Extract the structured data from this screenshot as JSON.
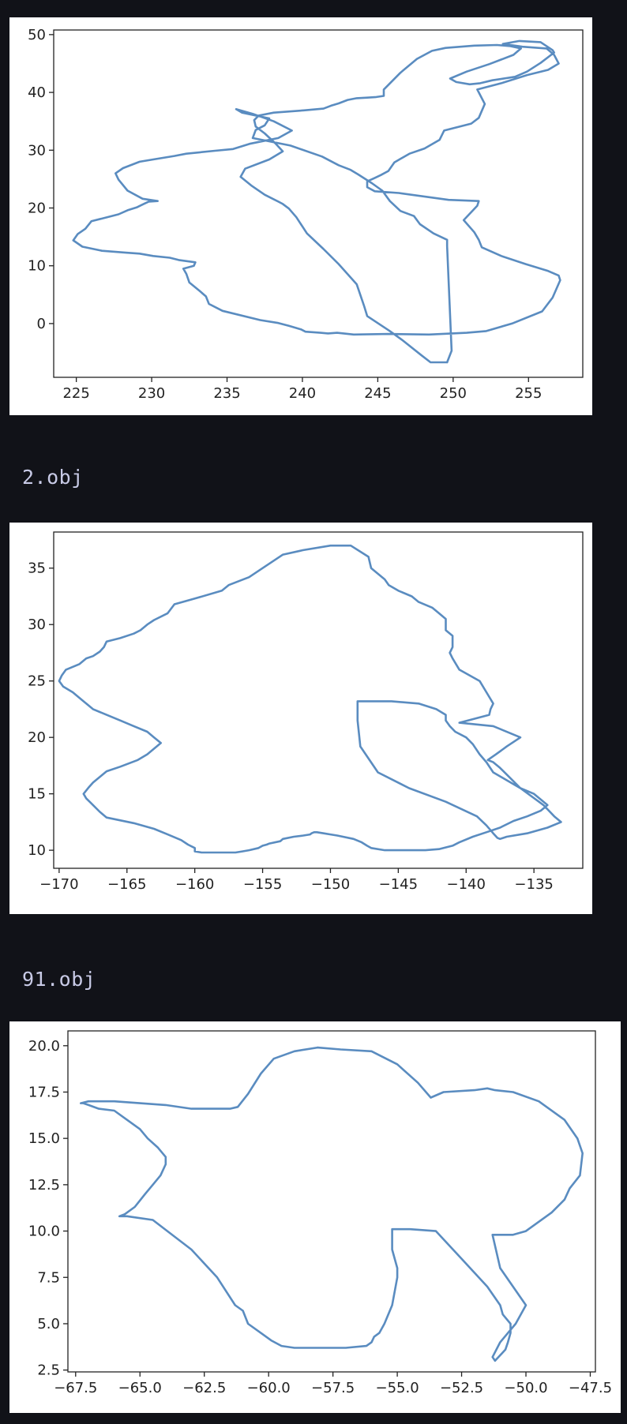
{
  "captions": [
    "2.obj",
    "91.obj"
  ],
  "colors": {
    "line": "#5a8cc0",
    "background": "#111218",
    "caption": "#c8cae6"
  },
  "chart_data": [
    {
      "type": "line",
      "title": "",
      "xlabel": "",
      "ylabel": "",
      "xlim": [
        223.5,
        258.6
      ],
      "ylim": [
        -9.3,
        50.8
      ],
      "xticks": [
        225,
        230,
        235,
        240,
        245,
        250,
        255
      ],
      "yticks": [
        0,
        10,
        20,
        30,
        40,
        50
      ],
      "grid": false,
      "legend": "none",
      "series": [
        {
          "x": [
            249.6,
            248.5,
            247.9,
            246.6,
            245.8,
            244.3,
            244.1,
            243.6,
            242.4,
            241.4,
            240.3,
            239.6,
            239.1,
            238.7,
            238.4,
            237.5,
            236.6,
            235.9,
            236.2,
            237.8,
            238.7,
            238.2,
            237.5,
            236.9,
            236.8,
            237.1,
            238.1,
            240.1,
            241.4,
            241.9,
            242.4,
            243.0,
            243.6,
            244.3,
            244.9,
            245.4,
            245.4,
            246.5,
            247.6,
            248.6,
            249.5,
            251.4,
            252.9,
            253.8,
            254.5,
            254.0,
            252.4,
            250.9,
            249.8,
            250.2,
            251.1,
            251.8,
            252.6,
            254.1,
            254.9,
            255.8,
            256.7,
            256.6,
            255.8,
            254.4,
            253.3,
            254.6,
            256.2,
            256.7,
            257.0,
            256.3,
            254.9,
            253.2,
            251.6,
            252.1,
            251.7,
            251.2,
            249.4,
            249.1,
            248.1,
            247.1,
            246.1,
            245.7,
            245.2,
            244.8,
            244.3,
            244.3,
            244.8,
            246.4,
            249.7,
            251.7,
            251.6,
            250.7,
            251.4,
            251.7,
            251.9,
            253.2,
            254.8,
            256.3,
            257.0,
            257.1,
            256.6,
            255.9,
            253.9,
            252.2,
            250.9,
            248.4,
            245.7,
            243.4,
            242.3,
            241.7,
            241.2,
            240.2,
            239.9,
            239.1,
            238.4,
            237.2,
            234.7,
            233.8,
            233.6,
            233.2,
            232.5,
            232.3,
            232.1,
            232.8,
            232.9,
            231.8,
            231.2,
            230.1,
            229.2,
            228.2,
            226.7,
            225.4,
            224.8,
            225.1,
            225.6,
            226.0,
            227.8,
            228.4,
            229.0,
            229.4,
            229.8,
            230.4,
            229.4,
            228.4,
            227.8,
            227.6,
            228.1,
            229.2,
            230.1,
            231.5,
            232.3,
            234.2,
            235.4,
            236.5,
            238.4,
            239.3,
            238.1,
            236.7,
            235.6,
            236.0,
            237.8,
            237.5,
            236.9,
            236.7,
            239.2,
            241.3,
            242.4,
            243.2,
            243.7,
            244.6,
            245.3,
            245.8,
            246.5,
            247.4,
            247.8,
            248.7,
            249.6,
            249.6,
            249.9,
            249.6
          ],
          "y": [
            -6.7,
            -6.7,
            -5.5,
            -2.8,
            -1.3,
            1.3,
            3.0,
            6.8,
            10.3,
            12.9,
            15.6,
            18.4,
            19.9,
            20.7,
            21.1,
            22.3,
            23.9,
            25.4,
            26.8,
            28.4,
            29.8,
            31.2,
            32.9,
            34.1,
            35.2,
            36.0,
            36.5,
            36.9,
            37.2,
            37.7,
            38.1,
            38.7,
            39.0,
            39.1,
            39.2,
            39.4,
            40.5,
            43.4,
            45.8,
            47.2,
            47.7,
            48.1,
            48.2,
            48.0,
            47.6,
            46.5,
            44.9,
            43.6,
            42.4,
            41.8,
            41.4,
            41.6,
            42.1,
            42.7,
            43.6,
            45.1,
            46.9,
            47.3,
            48.7,
            48.9,
            48.4,
            47.9,
            47.6,
            46.5,
            45.0,
            43.9,
            43.0,
            41.6,
            40.5,
            38.0,
            35.6,
            34.6,
            33.4,
            31.8,
            30.3,
            29.4,
            27.9,
            26.4,
            25.7,
            25.2,
            24.6,
            23.6,
            22.9,
            22.6,
            21.4,
            21.2,
            20.4,
            17.9,
            15.8,
            14.5,
            13.2,
            11.7,
            10.3,
            9.1,
            8.3,
            7.5,
            4.5,
            2.1,
            0.0,
            -1.3,
            -1.6,
            -1.9,
            -1.8,
            -1.9,
            -1.6,
            -1.7,
            -1.6,
            -1.4,
            -1.0,
            -0.4,
            0.1,
            0.6,
            2.2,
            3.4,
            4.7,
            5.6,
            7.1,
            8.6,
            9.5,
            10.0,
            10.6,
            11.0,
            11.4,
            11.7,
            12.1,
            12.3,
            12.6,
            13.3,
            14.4,
            15.5,
            16.4,
            17.7,
            18.9,
            19.6,
            20.1,
            20.6,
            21.1,
            21.2,
            21.6,
            23.0,
            24.9,
            26.0,
            26.9,
            28.0,
            28.4,
            29.0,
            29.4,
            29.9,
            30.2,
            31.1,
            32.1,
            33.4,
            35.0,
            36.3,
            37.1,
            36.5,
            35.5,
            34.3,
            33.5,
            32.1,
            30.8,
            28.9,
            27.4,
            26.6,
            25.8,
            24.3,
            23.0,
            21.2,
            19.5,
            18.6,
            17.2,
            15.6,
            14.5,
            13.4,
            -4.7,
            -6.7
          ]
        }
      ]
    },
    {
      "type": "line",
      "title": "",
      "xlabel": "",
      "ylabel": "",
      "xlim": [
        -170.4,
        -131.4
      ],
      "ylim": [
        8.4,
        38.2
      ],
      "xticks": [
        -170,
        -165,
        -160,
        -155,
        -150,
        -145,
        -140,
        -135
      ],
      "yticks": [
        10,
        15,
        20,
        25,
        30,
        35
      ],
      "grid": false,
      "legend": "none",
      "series": [
        {
          "x": [
            -148.0,
            -148.0,
            -147.8,
            -146.5,
            -144.2,
            -141.5,
            -139.2,
            -138.5,
            -138.0,
            -137.7,
            -137.5,
            -137.0,
            -135.5,
            -134.0,
            -133.0,
            -133.5,
            -134.3,
            -136.0,
            -137.0,
            -137.5,
            -138.0,
            -138.4,
            -137.8,
            -137.0,
            -136.0,
            -138.0,
            -140.5,
            -138.3,
            -138.2,
            -138.0,
            -138.5,
            -139.0,
            -140.5,
            -141.0,
            -141.2,
            -141.0,
            -141.0,
            -141.5,
            -141.5,
            -142.0,
            -142.5,
            -143.5,
            -144.0,
            -145.0,
            -145.7,
            -146.0,
            -146.5,
            -147.0,
            -147.2,
            -148.5,
            -150.0,
            -152.0,
            -153.5,
            -155.0,
            -156.0,
            -157.5,
            -158.0,
            -160.0,
            -161.5,
            -162.0,
            -163.0,
            -163.5,
            -164.0,
            -164.5,
            -165.5,
            -166.5,
            -166.7,
            -167.0,
            -167.5,
            -168.0,
            -168.5,
            -169.5,
            -169.8,
            -170.0,
            -169.7,
            -169.0,
            -168.5,
            -168.0,
            -167.5,
            -166.5,
            -165.5,
            -164.5,
            -163.5,
            -163.0,
            -162.5,
            -163.5,
            -164.2,
            -165.5,
            -166.5,
            -167.0,
            -167.5,
            -167.8,
            -168.0,
            -168.2,
            -168.0,
            -167.5,
            -167.0,
            -166.5,
            -164.5,
            -163.0,
            -162.0,
            -161.0,
            -160.5,
            -160.0,
            -160.0,
            -159.5,
            -158.5,
            -157.5,
            -157.0,
            -156.5,
            -156.0,
            -155.3,
            -155.0,
            -154.7,
            -154.5,
            -153.7,
            -153.5,
            -152.7,
            -152.0,
            -151.5,
            -151.4,
            -151.2,
            -151.0,
            -150.5,
            -150.0,
            -149.5,
            -148.3,
            -147.7,
            -147.3,
            -147.0,
            -146.0,
            -145.0,
            -144.0,
            -143.0,
            -142.0,
            -141.0,
            -140.5,
            -139.5,
            -138.5,
            -137.5,
            -136.5,
            -135.5,
            -134.5,
            -134.0,
            -134.5,
            -135.0,
            -136.0,
            -137.0,
            -138.0,
            -138.5,
            -139.0,
            -139.5,
            -140.0,
            -140.8,
            -141.2,
            -141.5,
            -141.5,
            -142.2,
            -143.5,
            -145.5,
            -147.0,
            -147.5,
            -148.0
          ],
          "y": [
            23.2,
            21.5,
            19.2,
            16.9,
            15.5,
            14.3,
            13.0,
            12.2,
            11.5,
            11.1,
            11.0,
            11.2,
            11.5,
            12.0,
            12.5,
            13.0,
            14.0,
            15.5,
            16.7,
            17.3,
            17.8,
            18.0,
            18.5,
            19.2,
            20.0,
            21.0,
            21.3,
            22.0,
            22.5,
            23.0,
            24.0,
            25.0,
            26.0,
            27.0,
            27.5,
            28.0,
            29.0,
            29.5,
            30.5,
            31.0,
            31.5,
            32.0,
            32.5,
            33.0,
            33.5,
            34.0,
            34.5,
            35.0,
            36.0,
            37.0,
            37.0,
            36.6,
            36.2,
            35.0,
            34.2,
            33.5,
            33.0,
            32.3,
            31.8,
            31.0,
            30.4,
            30.0,
            29.5,
            29.2,
            28.8,
            28.5,
            28.0,
            27.6,
            27.2,
            27.0,
            26.5,
            26.0,
            25.5,
            25.0,
            24.5,
            24.0,
            23.5,
            23.0,
            22.5,
            22.0,
            21.5,
            21.0,
            20.5,
            20.0,
            19.5,
            18.5,
            18.0,
            17.4,
            17.0,
            16.5,
            16.0,
            15.6,
            15.3,
            15.0,
            14.6,
            14.0,
            13.4,
            12.9,
            12.4,
            11.9,
            11.4,
            10.9,
            10.5,
            10.2,
            9.9,
            9.8,
            9.8,
            9.8,
            9.8,
            9.9,
            10.0,
            10.2,
            10.4,
            10.5,
            10.6,
            10.8,
            11.0,
            11.2,
            11.3,
            11.4,
            11.5,
            11.6,
            11.6,
            11.5,
            11.4,
            11.3,
            11.0,
            10.7,
            10.4,
            10.2,
            10.0,
            10.0,
            10.0,
            10.0,
            10.1,
            10.4,
            10.7,
            11.2,
            11.6,
            12.0,
            12.6,
            13.0,
            13.5,
            14.0,
            14.5,
            15.0,
            15.5,
            16.2,
            16.9,
            17.8,
            18.5,
            19.4,
            20.0,
            20.5,
            21.0,
            21.5,
            22.0,
            22.5,
            23.0,
            23.2,
            23.2,
            23.2,
            23.2
          ]
        }
      ]
    },
    {
      "type": "line",
      "title": "",
      "xlabel": "",
      "ylabel": "",
      "xlim": [
        -67.8,
        -47.3
      ],
      "ylim": [
        2.4,
        20.8
      ],
      "xticks": [
        -67.5,
        -65.0,
        -62.5,
        -60.0,
        -57.5,
        -55.0,
        -52.5,
        -50.0,
        -47.5
      ],
      "yticks": [
        2.5,
        5.0,
        7.5,
        10.0,
        12.5,
        15.0,
        17.5,
        20.0
      ],
      "grid": false,
      "legend": "none",
      "series": [
        {
          "x": [
            -58.1,
            -57.2,
            -56.0,
            -55.0,
            -54.2,
            -53.7,
            -53.2,
            -52.0,
            -51.5,
            -51.2,
            -50.5,
            -49.5,
            -48.5,
            -48.0,
            -47.8,
            -47.9,
            -48.3,
            -48.5,
            -49.0,
            -50.0,
            -50.5,
            -51.3,
            -51.0,
            -50.5,
            -50.0,
            -50.4,
            -51.0,
            -51.3,
            -51.2,
            -51.0,
            -50.8,
            -50.7,
            -50.6,
            -50.6,
            -50.9,
            -51.0,
            -51.5,
            -52.5,
            -53.5,
            -54.5,
            -55.2,
            -55.2,
            -55.0,
            -55.0,
            -55.2,
            -55.5,
            -55.7,
            -55.9,
            -56.0,
            -56.2,
            -57.0,
            -58.0,
            -59.0,
            -59.5,
            -59.9,
            -60.3,
            -60.8,
            -61.0,
            -61.3,
            -62.0,
            -63.0,
            -64.5,
            -65.5,
            -65.8,
            -65.8,
            -65.6,
            -65.2,
            -64.8,
            -64.5,
            -64.2,
            -64.0,
            -64.0,
            -64.3,
            -64.7,
            -65.0,
            -65.5,
            -66.0,
            -66.6,
            -67.0,
            -67.2,
            -67.3,
            -67.0,
            -66.5,
            -66.0,
            -65.0,
            -64.0,
            -63.0,
            -62.5,
            -62.0,
            -61.5,
            -61.2,
            -60.8,
            -60.3,
            -59.8,
            -59.0,
            -58.1
          ],
          "y": [
            19.9,
            19.8,
            19.7,
            19.0,
            18.0,
            17.2,
            17.5,
            17.6,
            17.7,
            17.6,
            17.5,
            17.0,
            16.0,
            15.0,
            14.2,
            13.0,
            12.3,
            11.7,
            11.0,
            10.0,
            9.8,
            9.8,
            8.0,
            7.0,
            6.0,
            5.0,
            4.0,
            3.2,
            3.0,
            3.3,
            3.6,
            4.0,
            4.5,
            5.0,
            5.5,
            6.0,
            7.0,
            8.5,
            10.0,
            10.1,
            10.1,
            9.0,
            8.0,
            7.5,
            6.0,
            5.0,
            4.5,
            4.3,
            4.0,
            3.8,
            3.7,
            3.7,
            3.7,
            3.8,
            4.1,
            4.5,
            5.0,
            5.7,
            6.0,
            7.5,
            9.0,
            10.6,
            10.8,
            10.8,
            10.8,
            10.9,
            11.3,
            12.0,
            12.5,
            13.0,
            13.6,
            14.0,
            14.5,
            15.0,
            15.5,
            16.0,
            16.5,
            16.6,
            16.8,
            16.9,
            16.9,
            17.0,
            17.0,
            17.0,
            16.9,
            16.8,
            16.6,
            16.6,
            16.6,
            16.6,
            16.7,
            17.4,
            18.5,
            19.3,
            19.7,
            19.9
          ]
        }
      ]
    }
  ]
}
